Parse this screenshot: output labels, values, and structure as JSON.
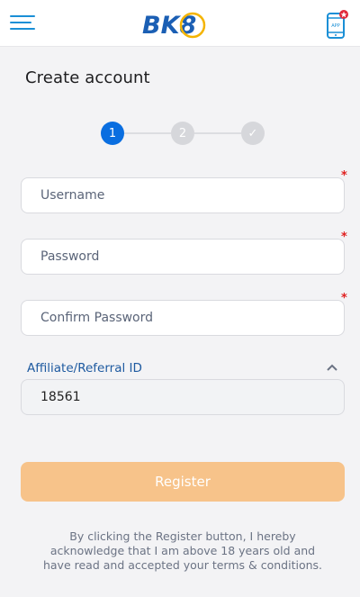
{
  "header": {
    "logo_text": "BK8",
    "app_badge_text": "APP",
    "icons": {
      "menu": "hamburger-menu-icon",
      "app": "mobile-app-icon"
    }
  },
  "page_title": "Create account",
  "stepper": {
    "steps": [
      "1",
      "2",
      "✓"
    ],
    "current": 1
  },
  "form": {
    "username": {
      "placeholder": "Username",
      "required": true
    },
    "password": {
      "placeholder": "Password",
      "required": true
    },
    "confirm_password": {
      "placeholder": "Confirm Password",
      "required": true
    },
    "affiliate": {
      "label": "Affiliate/Referral ID",
      "value": "18561",
      "expanded": true
    },
    "required_mark": "*"
  },
  "register_button": "Register",
  "disclaimer": "By clicking the Register button, I hereby acknowledge that I am above 18 years old and have read and accepted your terms & conditions.",
  "colors": {
    "accent_blue": "#0a6ee0",
    "brand_blue": "#1a8fd6",
    "register_button": "#f7c38a",
    "required_star": "#e02020"
  }
}
